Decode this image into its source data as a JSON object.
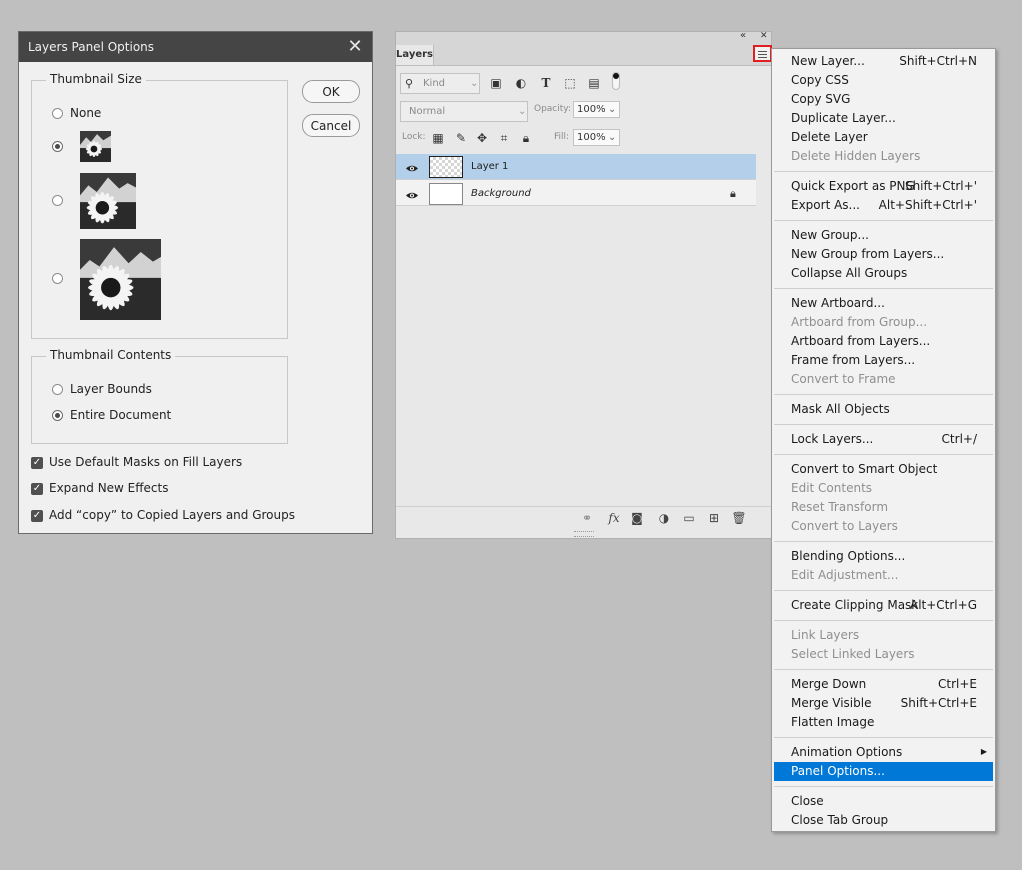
{
  "dialog": {
    "title": "Layers Panel Options",
    "thumbnail_size": {
      "legend": "Thumbnail Size",
      "options": [
        {
          "label": "None",
          "selected": false
        },
        {
          "label": "",
          "selected": true
        },
        {
          "label": "",
          "selected": false
        },
        {
          "label": "",
          "selected": false
        }
      ]
    },
    "thumbnail_contents": {
      "legend": "Thumbnail Contents",
      "options": [
        {
          "label": "Layer Bounds",
          "selected": false
        },
        {
          "label": "Entire Document",
          "selected": true
        }
      ]
    },
    "checkboxes": [
      {
        "label": "Use Default Masks on Fill Layers",
        "checked": true
      },
      {
        "label": "Expand New Effects",
        "checked": true
      },
      {
        "label": "Add “copy” to Copied Layers and Groups",
        "checked": true
      }
    ],
    "ok_label": "OK",
    "cancel_label": "Cancel"
  },
  "layers_panel": {
    "tab_label": "Layers",
    "filter_placeholder": "Kind",
    "blend_mode": "Normal",
    "opacity_label": "Opacity:",
    "opacity_value": "100%",
    "lock_label": "Lock:",
    "fill_label": "Fill:",
    "fill_value": "100%",
    "layers": [
      {
        "name": "Layer 1",
        "selected": true,
        "visible": true
      },
      {
        "name": "Background",
        "selected": false,
        "visible": true,
        "locked": true
      }
    ]
  },
  "menu": {
    "items": [
      {
        "label": "New Layer...",
        "shortcut": "Shift+Ctrl+N",
        "enabled": true
      },
      {
        "label": "Copy CSS",
        "shortcut": "",
        "enabled": true
      },
      {
        "label": "Copy SVG",
        "shortcut": "",
        "enabled": true
      },
      {
        "label": "Duplicate Layer...",
        "shortcut": "",
        "enabled": true
      },
      {
        "label": "Delete Layer",
        "shortcut": "",
        "enabled": true
      },
      {
        "label": "Delete Hidden Layers",
        "shortcut": "",
        "enabled": false
      },
      {
        "label": "Quick Export as PNG",
        "shortcut": "Shift+Ctrl+'",
        "enabled": true
      },
      {
        "label": "Export As...",
        "shortcut": "Alt+Shift+Ctrl+'",
        "enabled": true
      },
      {
        "label": "New Group...",
        "shortcut": "",
        "enabled": true
      },
      {
        "label": "New Group from Layers...",
        "shortcut": "",
        "enabled": true
      },
      {
        "label": "Collapse All Groups",
        "shortcut": "",
        "enabled": true
      },
      {
        "label": "New Artboard...",
        "shortcut": "",
        "enabled": true
      },
      {
        "label": "Artboard from Group...",
        "shortcut": "",
        "enabled": false
      },
      {
        "label": "Artboard from Layers...",
        "shortcut": "",
        "enabled": true
      },
      {
        "label": "Frame from Layers...",
        "shortcut": "",
        "enabled": true
      },
      {
        "label": "Convert to Frame",
        "shortcut": "",
        "enabled": false
      },
      {
        "label": "Mask All Objects",
        "shortcut": "",
        "enabled": true
      },
      {
        "label": "Lock Layers...",
        "shortcut": "Ctrl+/",
        "enabled": true
      },
      {
        "label": "Convert to Smart Object",
        "shortcut": "",
        "enabled": true
      },
      {
        "label": "Edit Contents",
        "shortcut": "",
        "enabled": false
      },
      {
        "label": "Reset Transform",
        "shortcut": "",
        "enabled": false
      },
      {
        "label": "Convert to Layers",
        "shortcut": "",
        "enabled": false
      },
      {
        "label": "Blending Options...",
        "shortcut": "",
        "enabled": true
      },
      {
        "label": "Edit Adjustment...",
        "shortcut": "",
        "enabled": false
      },
      {
        "label": "Create Clipping Mask",
        "shortcut": "Alt+Ctrl+G",
        "enabled": true
      },
      {
        "label": "Link Layers",
        "shortcut": "",
        "enabled": false
      },
      {
        "label": "Select Linked Layers",
        "shortcut": "",
        "enabled": false
      },
      {
        "label": "Merge Down",
        "shortcut": "Ctrl+E",
        "enabled": true
      },
      {
        "label": "Merge Visible",
        "shortcut": "Shift+Ctrl+E",
        "enabled": true
      },
      {
        "label": "Flatten Image",
        "shortcut": "",
        "enabled": true
      },
      {
        "label": "Animation Options",
        "shortcut": "",
        "enabled": true,
        "submenu": true
      },
      {
        "label": "Panel Options...",
        "shortcut": "",
        "enabled": true,
        "highlighted": true
      },
      {
        "label": "Close",
        "shortcut": "",
        "enabled": true
      },
      {
        "label": "Close Tab Group",
        "shortcut": "",
        "enabled": true
      }
    ]
  }
}
